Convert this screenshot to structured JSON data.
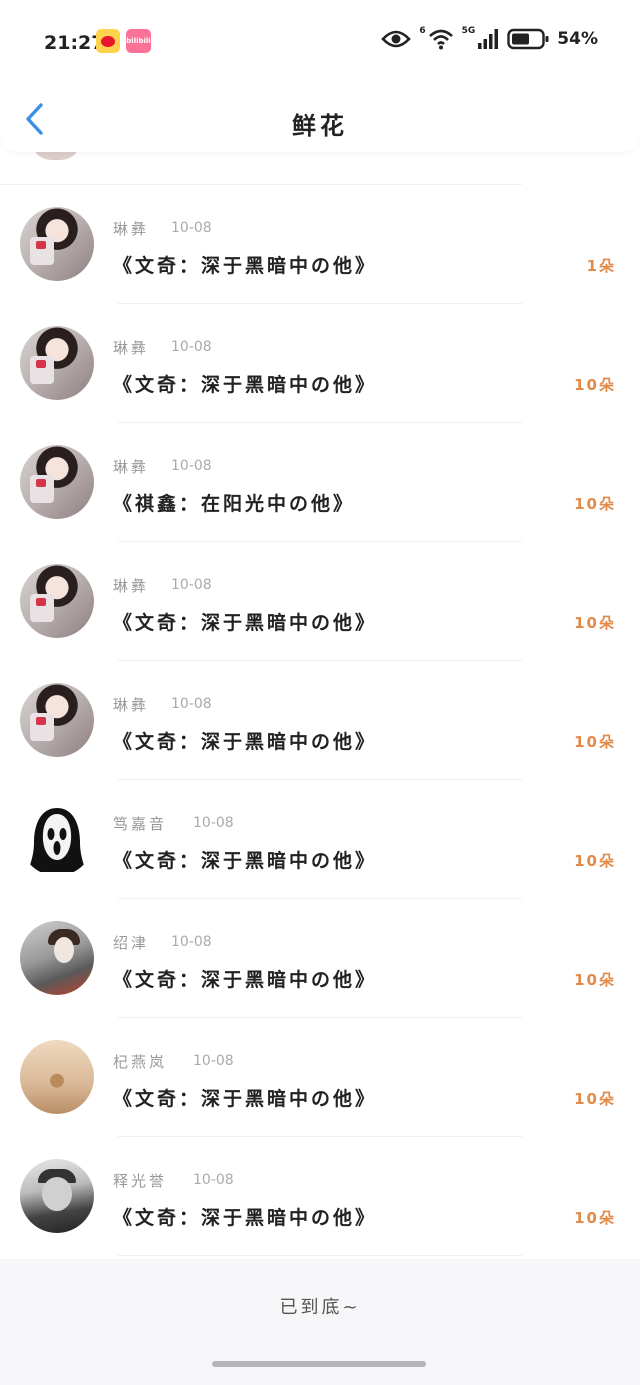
{
  "status_bar": {
    "time": "21:27",
    "bili_label": "bilibili",
    "network": "5G",
    "wifi_badge": "6",
    "battery": "54%",
    "icons": [
      "weibo-icon",
      "bilibili-icon",
      "eye-icon",
      "wifi-icon",
      "signal-icon",
      "battery-icon"
    ]
  },
  "header": {
    "title": "鲜花",
    "back_icon": "chevron-left-icon",
    "accent_color": "#3c8fe6"
  },
  "list": {
    "amount_color": "#e28a4a",
    "items": [
      {
        "name": "琳彝",
        "date": "10-08",
        "work": "《文奇：深于黑暗中の他》",
        "amount": "1朵",
        "avatar": "girl"
      },
      {
        "name": "琳彝",
        "date": "10-08",
        "work": "《文奇：深于黑暗中の他》",
        "amount": "10朵",
        "avatar": "girl"
      },
      {
        "name": "琳彝",
        "date": "10-08",
        "work": "《祺鑫：在阳光中の他》",
        "amount": "10朵",
        "avatar": "girl"
      },
      {
        "name": "琳彝",
        "date": "10-08",
        "work": "《文奇：深于黑暗中の他》",
        "amount": "10朵",
        "avatar": "girl"
      },
      {
        "name": "琳彝",
        "date": "10-08",
        "work": "《文奇：深于黑暗中の他》",
        "amount": "10朵",
        "avatar": "girl"
      },
      {
        "name": "笃嘉音",
        "date": "10-08",
        "work": "《文奇：深于黑暗中の他》",
        "amount": "10朵",
        "avatar": "ghost"
      },
      {
        "name": "绍津",
        "date": "10-08",
        "work": "《文奇：深于黑暗中の他》",
        "amount": "10朵",
        "avatar": "boy"
      },
      {
        "name": "杞燕岚",
        "date": "10-08",
        "work": "《文奇：深于黑暗中の他》",
        "amount": "10朵",
        "avatar": "warm"
      },
      {
        "name": "释光誉",
        "date": "10-08",
        "work": "《文奇：深于黑暗中の他》",
        "amount": "10朵",
        "avatar": "bw"
      }
    ]
  },
  "footer": {
    "end_text": "已到底~"
  }
}
